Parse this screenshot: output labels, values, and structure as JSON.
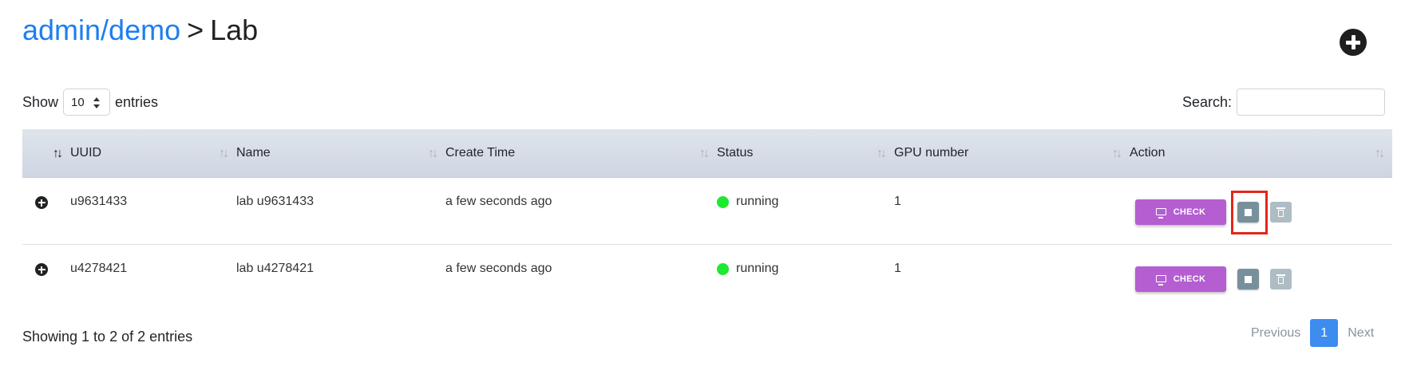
{
  "breadcrumb": {
    "link": "admin/demo",
    "separator": ">",
    "current": "Lab"
  },
  "header": {
    "add_icon": "plus-circle-icon"
  },
  "length": {
    "show_label": "Show",
    "selected": "10",
    "entries_label": "entries"
  },
  "search": {
    "label": "Search:",
    "value": ""
  },
  "table": {
    "columns": [
      "",
      "UUID",
      "Name",
      "Create Time",
      "Status",
      "GPU number",
      "Action"
    ],
    "sort_icon": "↑↓",
    "rows": [
      {
        "uuid": "u9631433",
        "name": "lab u9631433",
        "create_time": "a few seconds ago",
        "status": "running",
        "gpu": "1",
        "check_label": "CHECK"
      },
      {
        "uuid": "u4278421",
        "name": "lab u4278421",
        "create_time": "a few seconds ago",
        "status": "running",
        "gpu": "1",
        "check_label": "CHECK"
      }
    ]
  },
  "colors": {
    "link": "#1e7ef0",
    "check_button": "#b45ed1",
    "stop_button": "#78909c",
    "delete_button": "#aebdc4",
    "status_running": "#1ee830",
    "highlight": "#e3261c",
    "page_active": "#3d8cf0"
  },
  "footer": {
    "info": "Showing 1 to 2 of 2 entries",
    "previous": "Previous",
    "current_page": "1",
    "next": "Next"
  }
}
